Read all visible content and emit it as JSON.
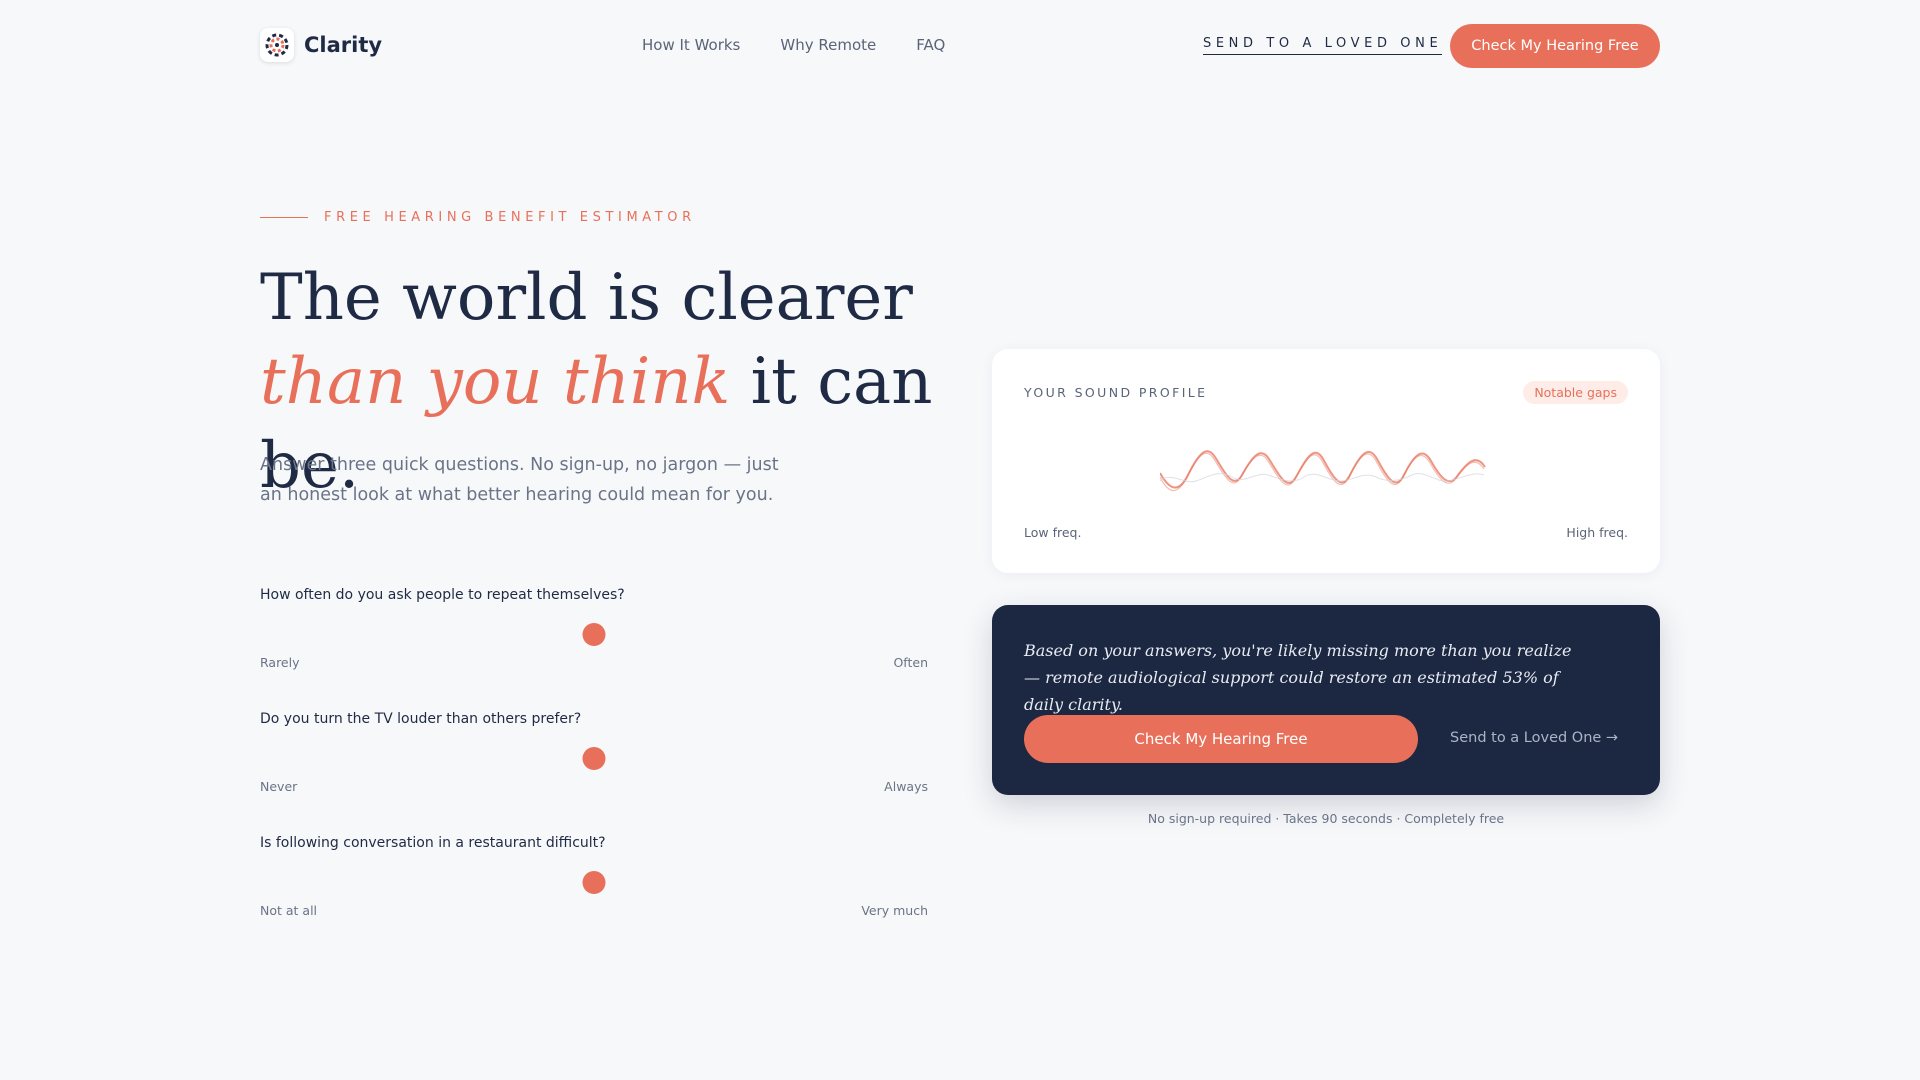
{
  "brand": {
    "name": "Clarity",
    "logo_icon": "sound-wheel-icon",
    "accent": "#e8705a",
    "navy": "#1c2841"
  },
  "nav": {
    "items": [
      {
        "label": "How It Works"
      },
      {
        "label": "Why Remote"
      },
      {
        "label": "FAQ"
      }
    ]
  },
  "header": {
    "send_link": "SEND TO A LOVED ONE",
    "cta": "Check My Hearing Free"
  },
  "hero": {
    "eyebrow": "FREE HEARING BENEFIT ESTIMATOR",
    "headline_line1": "The world is clearer",
    "headline_accent": "than you think",
    "headline_rest": " it can be.",
    "subtext": "Answer three quick questions. No sign-up, no jargon — just an honest look at what better hearing could mean for you."
  },
  "questions": [
    {
      "label": "How often do you ask people to repeat themselves?",
      "min_label": "Rarely",
      "max_label": "Often",
      "value": 0.5
    },
    {
      "label": "Do you turn the TV louder than others prefer?",
      "min_label": "Never",
      "max_label": "Always",
      "value": 0.5
    },
    {
      "label": "Is following conversation in a restaurant difficult?",
      "min_label": "Not at all",
      "max_label": "Very much",
      "value": 0.5
    }
  ],
  "profile": {
    "title": "YOUR SOUND PROFILE",
    "badge": "Notable gaps",
    "low_label": "Low freq.",
    "high_label": "High freq."
  },
  "result": {
    "text": "Based on your answers, you're likely missing more than you realize — remote audiological support could restore an estimated 53% of daily clarity.",
    "cta": "Check My Hearing Free",
    "link": "Send to a Loved One →"
  },
  "footnote": "No sign-up required · Takes 90 seconds · Completely free"
}
